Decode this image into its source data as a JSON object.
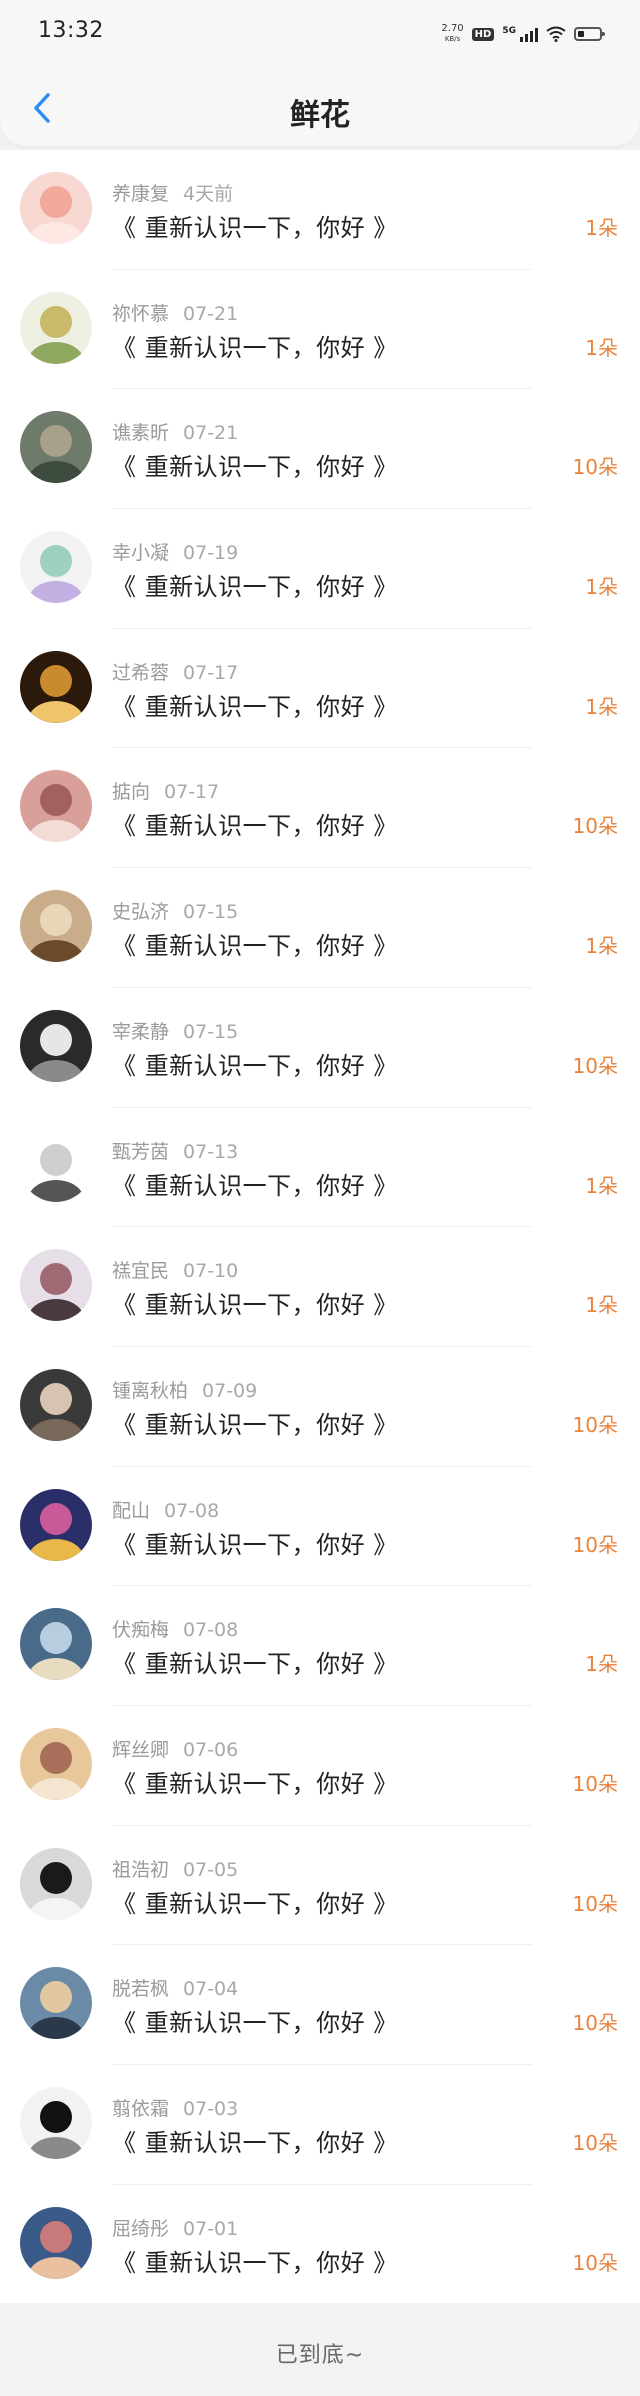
{
  "status_bar": {
    "time": "13:32",
    "net_speed_value": "2.70",
    "net_speed_unit": "KB/s",
    "hd_badge": "HD",
    "network": "5G",
    "icons": [
      "hd-icon",
      "signal-icon",
      "wifi-icon",
      "battery-icon"
    ]
  },
  "header": {
    "back_icon": "chevron-left-icon",
    "title": "鲜花",
    "accent_color": "#2b8ff5"
  },
  "gift_text": "《 重新认识一下，你好 》",
  "count_color": "#e8833c",
  "items": [
    {
      "name": "养康复",
      "date": "4天前",
      "count": "1朵",
      "avatar": "anime-girl-avatar"
    },
    {
      "name": "祢怀慕",
      "date": "07-21",
      "count": "1朵",
      "avatar": "lotus-flower-avatar"
    },
    {
      "name": "谯素昕",
      "date": "07-21",
      "count": "10朵",
      "avatar": "desk-items-avatar"
    },
    {
      "name": "幸小凝",
      "date": "07-19",
      "count": "1朵",
      "avatar": "cartoon-faces-avatar"
    },
    {
      "name": "过希蓉",
      "date": "07-17",
      "count": "1朵",
      "avatar": "night-building-avatar"
    },
    {
      "name": "掂向",
      "date": "07-17",
      "count": "10朵",
      "avatar": "portrait-avatar"
    },
    {
      "name": "史弘济",
      "date": "07-15",
      "count": "1朵",
      "avatar": "sketch-drawing-avatar"
    },
    {
      "name": "宰柔静",
      "date": "07-15",
      "count": "10朵",
      "avatar": "photo-avatar"
    },
    {
      "name": "甄芳茵",
      "date": "07-13",
      "count": "1朵",
      "avatar": "line-art-avatar"
    },
    {
      "name": "禚宜民",
      "date": "07-10",
      "count": "1朵",
      "avatar": "blossom-avatar"
    },
    {
      "name": "锺离秋柏",
      "date": "07-09",
      "count": "10朵",
      "avatar": "girl-photo-avatar"
    },
    {
      "name": "配山",
      "date": "07-08",
      "count": "10朵",
      "avatar": "colorful-art-avatar"
    },
    {
      "name": "伏痴梅",
      "date": "07-08",
      "count": "1朵",
      "avatar": "sky-avatar"
    },
    {
      "name": "辉丝卿",
      "date": "07-06",
      "count": "10朵",
      "avatar": "selfie-avatar"
    },
    {
      "name": "祖浩初",
      "date": "07-05",
      "count": "10朵",
      "avatar": "hand-avatar"
    },
    {
      "name": "脱若枫",
      "date": "07-04",
      "count": "10朵",
      "avatar": "two-kids-avatar"
    },
    {
      "name": "翦依霜",
      "date": "07-03",
      "count": "10朵",
      "avatar": "black-white-art-avatar"
    },
    {
      "name": "屈绮彤",
      "date": "07-01",
      "count": "10朵",
      "avatar": "couple-photo-avatar"
    }
  ],
  "footer": {
    "text": "已到底~"
  }
}
